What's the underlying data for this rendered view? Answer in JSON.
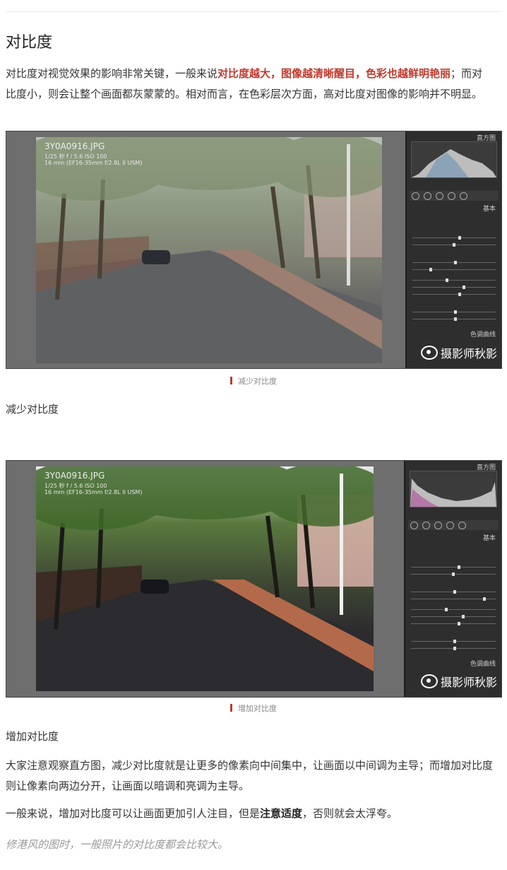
{
  "title": "对比度",
  "intro": {
    "text1": "对比度对视觉效果的影响非常关键，一般来说",
    "highlight": "对比度越大，图像越清晰醒目，色彩也越鲜明艳丽",
    "text2": "；而对比度小，则会让整个画面都灰蒙蒙的。相对而言，在色彩层次方面，高对比度对图像的影响并不明显。"
  },
  "screenshots": [
    {
      "filename": "3Y0A0916.JPG",
      "meta1": "1/25 秒 f / 5.6 ISO 100",
      "meta2": "16 mm (EF16-35mm f/2.8L II USM)",
      "panel_top": "直方图",
      "panel_basic": "基本",
      "panel_tone": "色调曲线",
      "watermark": "摄影师秋影",
      "caption": "减少对比度"
    },
    {
      "filename": "3Y0A0916.JPG",
      "meta1": "1/25 秒 f / 5.6 ISO 100",
      "meta2": "16 mm (EF16-35mm f/2.8L II USM)",
      "panel_top": "直方图",
      "panel_basic": "基本",
      "panel_tone": "色调曲线",
      "watermark": "摄影师秋影",
      "caption": "增加对比度"
    }
  ],
  "heading_reduce": "减少对比度",
  "heading_increase": "增加对比度",
  "para2": "大家注意观察直方图，减少对比度就是让更多的像素向中间集中，让画面以中间调为主导；而增加对比度则让像素向两边分开，让画面以暗调和亮调为主导。",
  "para3": {
    "text1": "一般来说，增加对比度可以让画面更加引人注目，但是",
    "bold": "注意适度",
    "text2": "，否则就会太浮夸。"
  },
  "para4": "修港风的图时，一般照片的对比度都会比较大。",
  "colors": {
    "highlight": "#c0392b",
    "panel": "#2e2e2e"
  }
}
